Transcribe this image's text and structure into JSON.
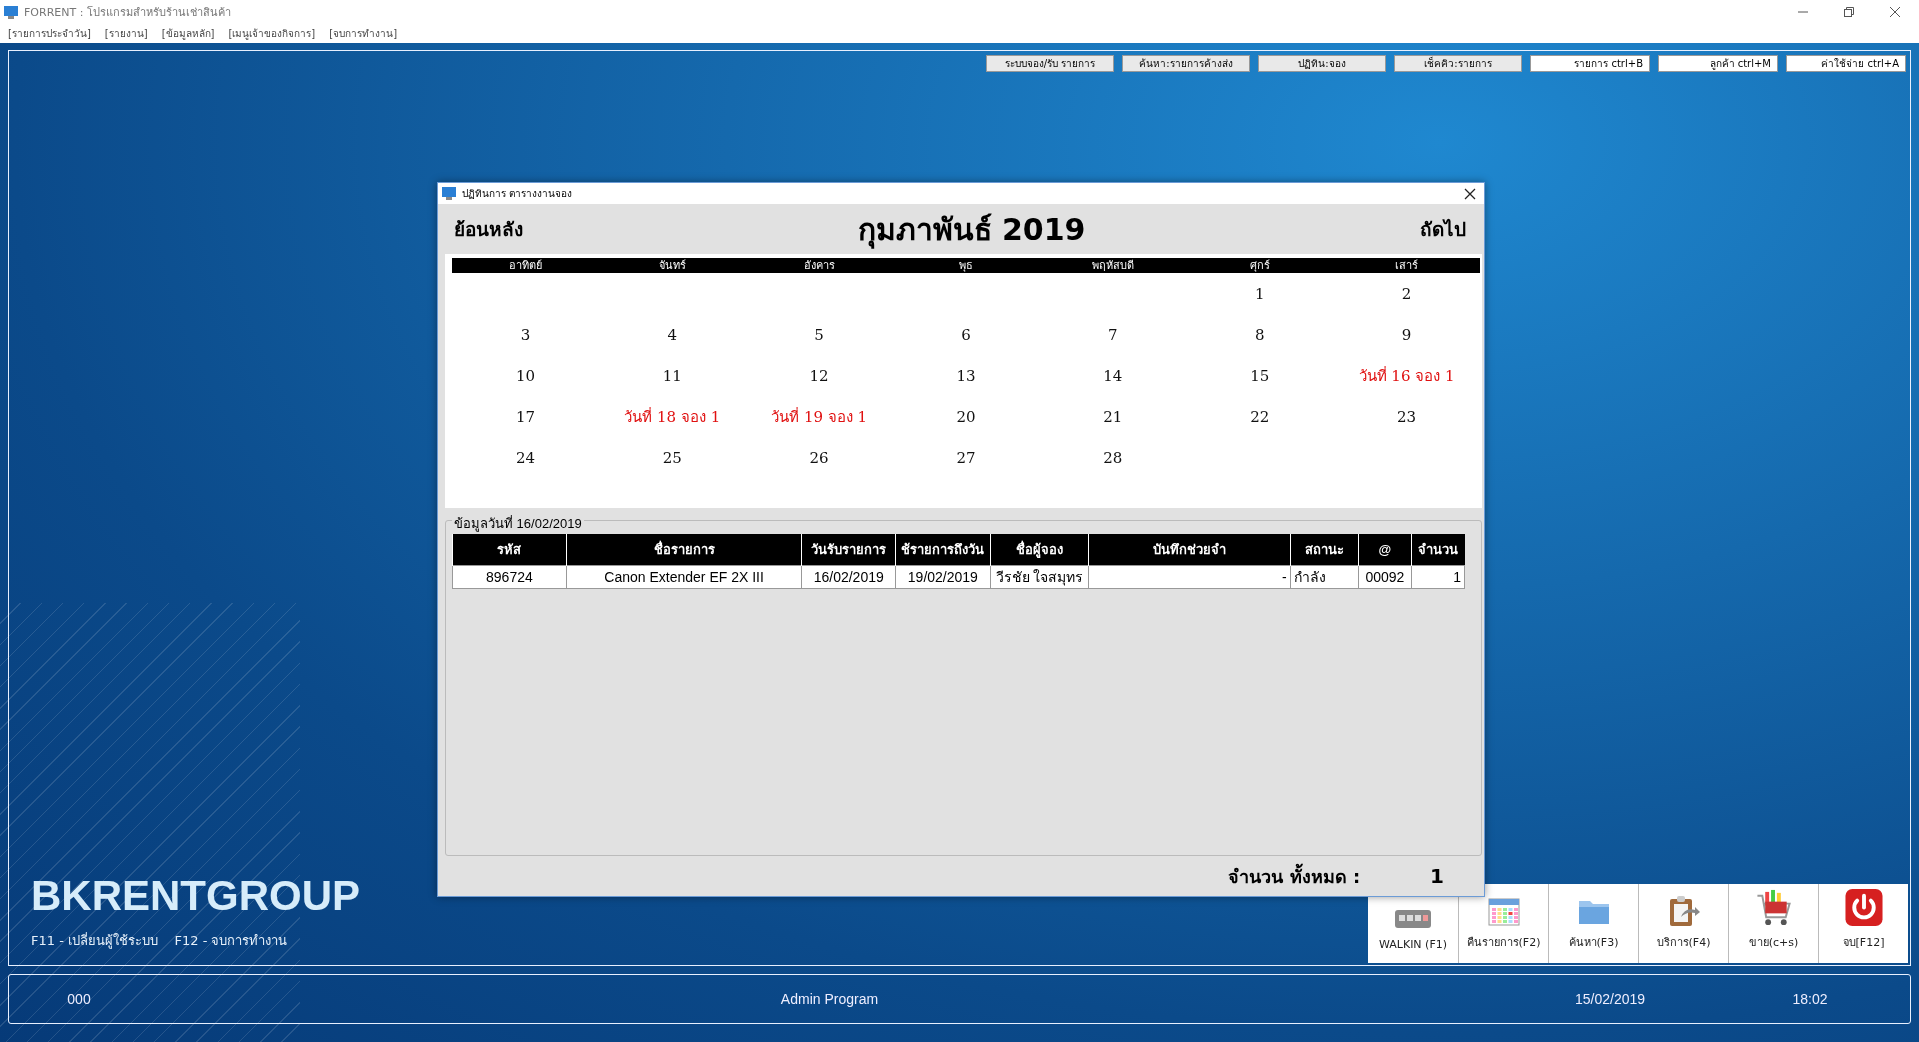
{
  "window": {
    "title": "FORRENT : โปรแกรมสำหรับร้านเช่าสินค้า"
  },
  "menu": [
    "[รายการประจำวัน]",
    "[รายงาน]",
    "[ข้อมูลหลัก]",
    "[เมนูเจ้าของกิจการ]",
    "[จบการทำงาน]"
  ],
  "top_buttons": [
    {
      "label": "ระบบจอง/รับ รายการ",
      "kind": "center"
    },
    {
      "label": "ค้นหา:รายการค้างส่ง",
      "kind": "center"
    },
    {
      "label": "ปฏิทิน:จอง",
      "kind": "center"
    },
    {
      "label": "เช็คคิว:รายการ",
      "kind": "center"
    },
    {
      "label": "รายการ ctrl+B",
      "kind": "shortcut"
    },
    {
      "label": "ลูกค้า ctrl+M",
      "kind": "shortcut"
    },
    {
      "label": "ค่าใช้จ่าย ctrl+A",
      "kind": "shortcut"
    }
  ],
  "dialog": {
    "title": "ปฏิทินการ ตารางงานจอง",
    "prev": "ย้อนหลัง",
    "month": "กุมภาพันธ์ 2019",
    "next": "ถัดไป",
    "weekdays": [
      "อาทิตย์",
      "จันทร์",
      "อังคาร",
      "พุธ",
      "พฤหัสบดี",
      "ศุกร์",
      "เสาร์"
    ],
    "weeks": [
      [
        {
          "kind": "blank"
        },
        {
          "kind": "blank"
        },
        {
          "kind": "blank"
        },
        {
          "kind": "blank"
        },
        {
          "kind": "blank"
        },
        {
          "kind": "day",
          "text": "1",
          "booked": false
        },
        {
          "kind": "day",
          "text": "2",
          "booked": false
        }
      ],
      [
        {
          "text": "3",
          "booked": false
        },
        {
          "text": "4",
          "booked": false
        },
        {
          "text": "5",
          "booked": false
        },
        {
          "text": "6",
          "booked": false
        },
        {
          "text": "7",
          "booked": false
        },
        {
          "text": "8",
          "booked": false
        },
        {
          "text": "9",
          "booked": false
        }
      ],
      [
        {
          "text": "10",
          "booked": false
        },
        {
          "text": "11",
          "booked": false
        },
        {
          "text": "12",
          "booked": false
        },
        {
          "text": "13",
          "booked": false
        },
        {
          "text": "14",
          "booked": false
        },
        {
          "text": "15",
          "booked": false
        },
        {
          "text": "วันที่ 16 จอง 1",
          "booked": true
        }
      ],
      [
        {
          "text": "17",
          "booked": false
        },
        {
          "text": "วันที่ 18 จอง 1",
          "booked": true
        },
        {
          "text": "วันที่ 19 จอง 1",
          "booked": true
        },
        {
          "text": "20",
          "booked": false
        },
        {
          "text": "21",
          "booked": false
        },
        {
          "text": "22",
          "booked": false
        },
        {
          "text": "23",
          "booked": false
        }
      ],
      [
        {
          "text": "24",
          "booked": false
        },
        {
          "text": "25",
          "booked": false
        },
        {
          "text": "26",
          "booked": false
        },
        {
          "text": "27",
          "booked": false
        },
        {
          "text": "28",
          "booked": false
        },
        {
          "kind": "blank"
        },
        {
          "kind": "blank"
        }
      ]
    ],
    "detail_label": "ข้อมูลวันที่  16/02/2019",
    "table": {
      "columns": [
        "รหัส",
        "ชื่อรายการ",
        "วันรับรายการ",
        "ช้รายการถึงวัน",
        "ชื่อผู้จอง",
        "บันทึกช่วยจำ",
        "สถานะ",
        "@",
        "จำนวน"
      ],
      "rows": [
        {
          "cells": [
            "896724",
            "Canon Extender EF 2X III",
            "16/02/2019",
            "19/02/2019",
            "วีรชัย ใจสมุทร",
            "-",
            "กำลัง",
            "00092",
            "1"
          ]
        }
      ]
    },
    "total_label": "จำนวน ทั้งหมด :",
    "total": "1"
  },
  "brand": "BKRENTGROUP",
  "hotkeys": "F11 - เปลี่ยนผู้ใช้ระบบ    F12 - จบการทำงาน",
  "toolbar": [
    {
      "label": "WALKIN  (F1)",
      "kind": "keyboard"
    },
    {
      "label": "คืนรายการ(F2)",
      "kind": "calendar"
    },
    {
      "label": "ค้นหา(F3)",
      "kind": "folder"
    },
    {
      "label": "บริการ(F4)",
      "kind": "clipboard"
    },
    {
      "label": "ขาย(c+s)",
      "kind": "cart"
    },
    {
      "label": "จบ[F12]",
      "kind": "power"
    }
  ],
  "status_bar": {
    "code": "000",
    "user": "Admin Program",
    "date": "15/02/2019",
    "time": "18:02"
  }
}
